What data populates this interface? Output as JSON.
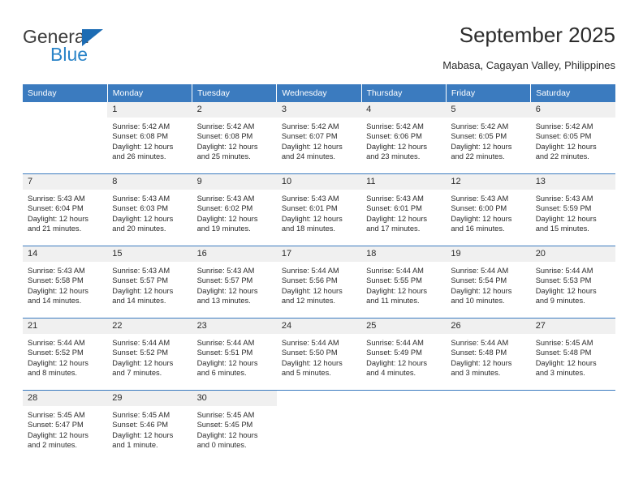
{
  "brand": {
    "name_top": "General",
    "name_bottom": "Blue",
    "triangle_color": "#1c6cb4",
    "blue_text_color": "#2a84c8"
  },
  "header": {
    "title": "September 2025",
    "location": "Mabasa, Cagayan Valley, Philippines"
  },
  "theme": {
    "header_row_bg": "#3b7bbf",
    "header_row_text": "#ffffff",
    "daynum_band_bg": "#f0f0f0",
    "row_divider": "#3b7bbf"
  },
  "weekday_headers": [
    "Sunday",
    "Monday",
    "Tuesday",
    "Wednesday",
    "Thursday",
    "Friday",
    "Saturday"
  ],
  "labels": {
    "sunrise_prefix": "Sunrise:",
    "sunset_prefix": "Sunset:",
    "daylight_prefix": "Daylight:"
  },
  "weeks": [
    [
      {
        "day": "",
        "l1": "",
        "l2": "",
        "l3": "",
        "l4": ""
      },
      {
        "day": "1",
        "l1": "Sunrise: 5:42 AM",
        "l2": "Sunset: 6:08 PM",
        "l3": "Daylight: 12 hours",
        "l4": "and 26 minutes."
      },
      {
        "day": "2",
        "l1": "Sunrise: 5:42 AM",
        "l2": "Sunset: 6:08 PM",
        "l3": "Daylight: 12 hours",
        "l4": "and 25 minutes."
      },
      {
        "day": "3",
        "l1": "Sunrise: 5:42 AM",
        "l2": "Sunset: 6:07 PM",
        "l3": "Daylight: 12 hours",
        "l4": "and 24 minutes."
      },
      {
        "day": "4",
        "l1": "Sunrise: 5:42 AM",
        "l2": "Sunset: 6:06 PM",
        "l3": "Daylight: 12 hours",
        "l4": "and 23 minutes."
      },
      {
        "day": "5",
        "l1": "Sunrise: 5:42 AM",
        "l2": "Sunset: 6:05 PM",
        "l3": "Daylight: 12 hours",
        "l4": "and 22 minutes."
      },
      {
        "day": "6",
        "l1": "Sunrise: 5:42 AM",
        "l2": "Sunset: 6:05 PM",
        "l3": "Daylight: 12 hours",
        "l4": "and 22 minutes."
      }
    ],
    [
      {
        "day": "7",
        "l1": "Sunrise: 5:43 AM",
        "l2": "Sunset: 6:04 PM",
        "l3": "Daylight: 12 hours",
        "l4": "and 21 minutes."
      },
      {
        "day": "8",
        "l1": "Sunrise: 5:43 AM",
        "l2": "Sunset: 6:03 PM",
        "l3": "Daylight: 12 hours",
        "l4": "and 20 minutes."
      },
      {
        "day": "9",
        "l1": "Sunrise: 5:43 AM",
        "l2": "Sunset: 6:02 PM",
        "l3": "Daylight: 12 hours",
        "l4": "and 19 minutes."
      },
      {
        "day": "10",
        "l1": "Sunrise: 5:43 AM",
        "l2": "Sunset: 6:01 PM",
        "l3": "Daylight: 12 hours",
        "l4": "and 18 minutes."
      },
      {
        "day": "11",
        "l1": "Sunrise: 5:43 AM",
        "l2": "Sunset: 6:01 PM",
        "l3": "Daylight: 12 hours",
        "l4": "and 17 minutes."
      },
      {
        "day": "12",
        "l1": "Sunrise: 5:43 AM",
        "l2": "Sunset: 6:00 PM",
        "l3": "Daylight: 12 hours",
        "l4": "and 16 minutes."
      },
      {
        "day": "13",
        "l1": "Sunrise: 5:43 AM",
        "l2": "Sunset: 5:59 PM",
        "l3": "Daylight: 12 hours",
        "l4": "and 15 minutes."
      }
    ],
    [
      {
        "day": "14",
        "l1": "Sunrise: 5:43 AM",
        "l2": "Sunset: 5:58 PM",
        "l3": "Daylight: 12 hours",
        "l4": "and 14 minutes."
      },
      {
        "day": "15",
        "l1": "Sunrise: 5:43 AM",
        "l2": "Sunset: 5:57 PM",
        "l3": "Daylight: 12 hours",
        "l4": "and 14 minutes."
      },
      {
        "day": "16",
        "l1": "Sunrise: 5:43 AM",
        "l2": "Sunset: 5:57 PM",
        "l3": "Daylight: 12 hours",
        "l4": "and 13 minutes."
      },
      {
        "day": "17",
        "l1": "Sunrise: 5:44 AM",
        "l2": "Sunset: 5:56 PM",
        "l3": "Daylight: 12 hours",
        "l4": "and 12 minutes."
      },
      {
        "day": "18",
        "l1": "Sunrise: 5:44 AM",
        "l2": "Sunset: 5:55 PM",
        "l3": "Daylight: 12 hours",
        "l4": "and 11 minutes."
      },
      {
        "day": "19",
        "l1": "Sunrise: 5:44 AM",
        "l2": "Sunset: 5:54 PM",
        "l3": "Daylight: 12 hours",
        "l4": "and 10 minutes."
      },
      {
        "day": "20",
        "l1": "Sunrise: 5:44 AM",
        "l2": "Sunset: 5:53 PM",
        "l3": "Daylight: 12 hours",
        "l4": "and 9 minutes."
      }
    ],
    [
      {
        "day": "21",
        "l1": "Sunrise: 5:44 AM",
        "l2": "Sunset: 5:52 PM",
        "l3": "Daylight: 12 hours",
        "l4": "and 8 minutes."
      },
      {
        "day": "22",
        "l1": "Sunrise: 5:44 AM",
        "l2": "Sunset: 5:52 PM",
        "l3": "Daylight: 12 hours",
        "l4": "and 7 minutes."
      },
      {
        "day": "23",
        "l1": "Sunrise: 5:44 AM",
        "l2": "Sunset: 5:51 PM",
        "l3": "Daylight: 12 hours",
        "l4": "and 6 minutes."
      },
      {
        "day": "24",
        "l1": "Sunrise: 5:44 AM",
        "l2": "Sunset: 5:50 PM",
        "l3": "Daylight: 12 hours",
        "l4": "and 5 minutes."
      },
      {
        "day": "25",
        "l1": "Sunrise: 5:44 AM",
        "l2": "Sunset: 5:49 PM",
        "l3": "Daylight: 12 hours",
        "l4": "and 4 minutes."
      },
      {
        "day": "26",
        "l1": "Sunrise: 5:44 AM",
        "l2": "Sunset: 5:48 PM",
        "l3": "Daylight: 12 hours",
        "l4": "and 3 minutes."
      },
      {
        "day": "27",
        "l1": "Sunrise: 5:45 AM",
        "l2": "Sunset: 5:48 PM",
        "l3": "Daylight: 12 hours",
        "l4": "and 3 minutes."
      }
    ],
    [
      {
        "day": "28",
        "l1": "Sunrise: 5:45 AM",
        "l2": "Sunset: 5:47 PM",
        "l3": "Daylight: 12 hours",
        "l4": "and 2 minutes."
      },
      {
        "day": "29",
        "l1": "Sunrise: 5:45 AM",
        "l2": "Sunset: 5:46 PM",
        "l3": "Daylight: 12 hours",
        "l4": "and 1 minute."
      },
      {
        "day": "30",
        "l1": "Sunrise: 5:45 AM",
        "l2": "Sunset: 5:45 PM",
        "l3": "Daylight: 12 hours",
        "l4": "and 0 minutes."
      },
      {
        "day": "",
        "l1": "",
        "l2": "",
        "l3": "",
        "l4": ""
      },
      {
        "day": "",
        "l1": "",
        "l2": "",
        "l3": "",
        "l4": ""
      },
      {
        "day": "",
        "l1": "",
        "l2": "",
        "l3": "",
        "l4": ""
      },
      {
        "day": "",
        "l1": "",
        "l2": "",
        "l3": "",
        "l4": ""
      }
    ]
  ]
}
